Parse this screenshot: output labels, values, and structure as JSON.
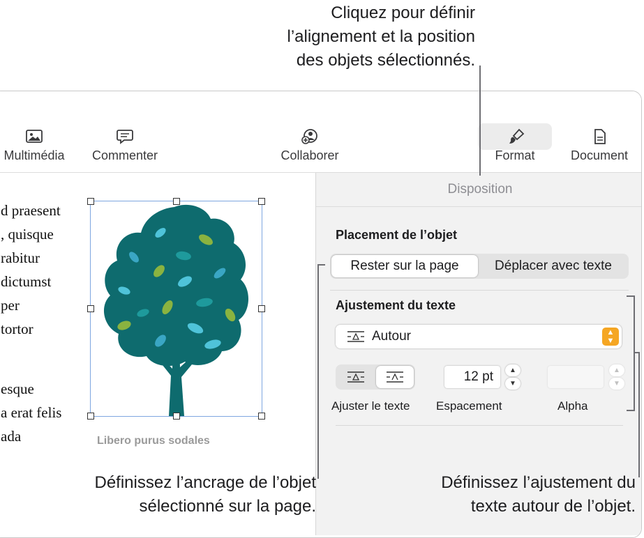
{
  "callouts": {
    "top": [
      "Cliquez pour définir",
      "l’alignement et la position",
      "des objets sélectionnés."
    ],
    "bottom_left": [
      "Définissez l’ancrage de l’objet",
      "sélectionné sur la page."
    ],
    "bottom_right": [
      "Définissez l’ajustement du",
      "texte autour de l’objet."
    ]
  },
  "toolbar": {
    "media": {
      "label": "Multimédia",
      "icon": "photo-icon"
    },
    "comment": {
      "label": "Commenter",
      "icon": "comment-icon"
    },
    "collaborate": {
      "label": "Collaborer",
      "icon": "collaborate-icon"
    },
    "format": {
      "label": "Format",
      "icon": "paintbrush-icon"
    },
    "document": {
      "label": "Document",
      "icon": "document-icon"
    }
  },
  "document": {
    "lines": [
      "d praesent",
      ", quisque",
      "rabitur",
      "dictumst",
      "per",
      "tortor",
      "",
      "esque",
      "a erat felis",
      "ada"
    ],
    "image_caption": "Libero purus sodales"
  },
  "panel": {
    "tab": "Disposition",
    "placement_title": "Placement de l’objet",
    "placement_options": [
      "Rester sur la page",
      "Déplacer avec texte"
    ],
    "placement_selected": "Rester sur la page",
    "wrap_title": "Ajustement du texte",
    "wrap_value": "Autour",
    "fit_label": "Ajuster le texte",
    "spacing_value": "12 pt",
    "spacing_label": "Espacement",
    "alpha_value": "",
    "alpha_label": "Alpha"
  },
  "colors": {
    "accent": "#f5a623",
    "tree": "#0e6b6e"
  }
}
